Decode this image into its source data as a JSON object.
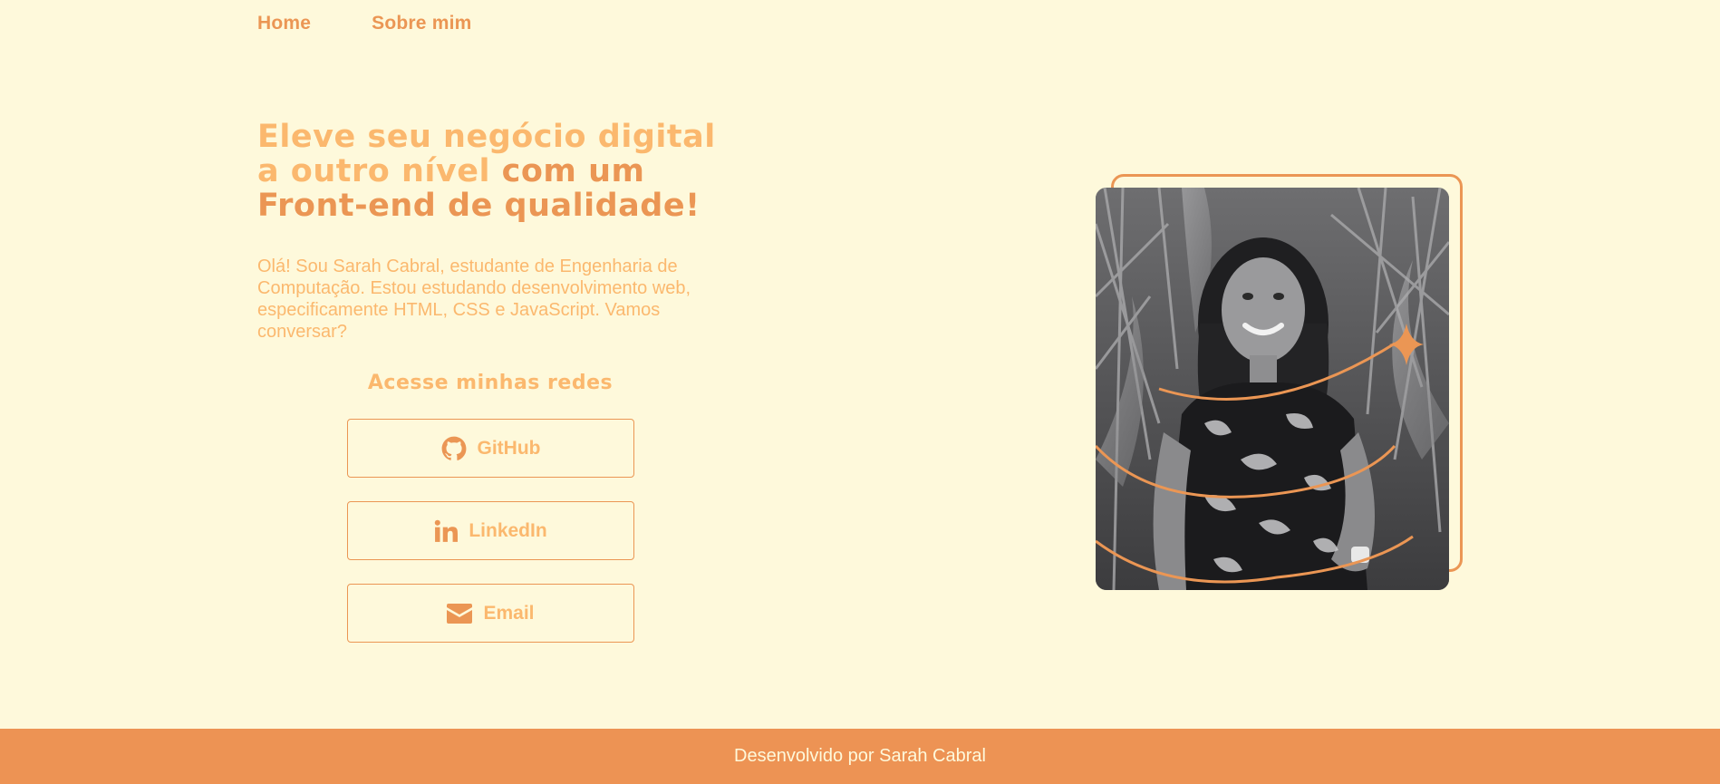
{
  "nav": {
    "home": "Home",
    "about": "Sobre mim"
  },
  "hero": {
    "title_light": "Eleve seu negócio digital a outro nível",
    "title_dark": " com um Front-end de qualidade!",
    "intro": "Olá! Sou Sarah Cabral, estudante de Engenharia de Computação. Estou estudando desenvolvimento web, especificamente HTML, CSS e JavaScript. Vamos conversar?"
  },
  "networks": {
    "title": "Acesse minhas redes",
    "buttons": [
      {
        "label": "GitHub",
        "icon": "github-icon"
      },
      {
        "label": "LinkedIn",
        "icon": "linkedin-icon"
      },
      {
        "label": "Email",
        "icon": "envelope-icon"
      }
    ]
  },
  "photo": {
    "alt": "Foto de Sarah Cabral"
  },
  "footer": {
    "text": "Desenvolvido por Sarah Cabral"
  },
  "colors": {
    "background": "#fef9db",
    "accent": "#eb9654",
    "accent_light": "#fbb86e",
    "footer": "#ed9354"
  }
}
